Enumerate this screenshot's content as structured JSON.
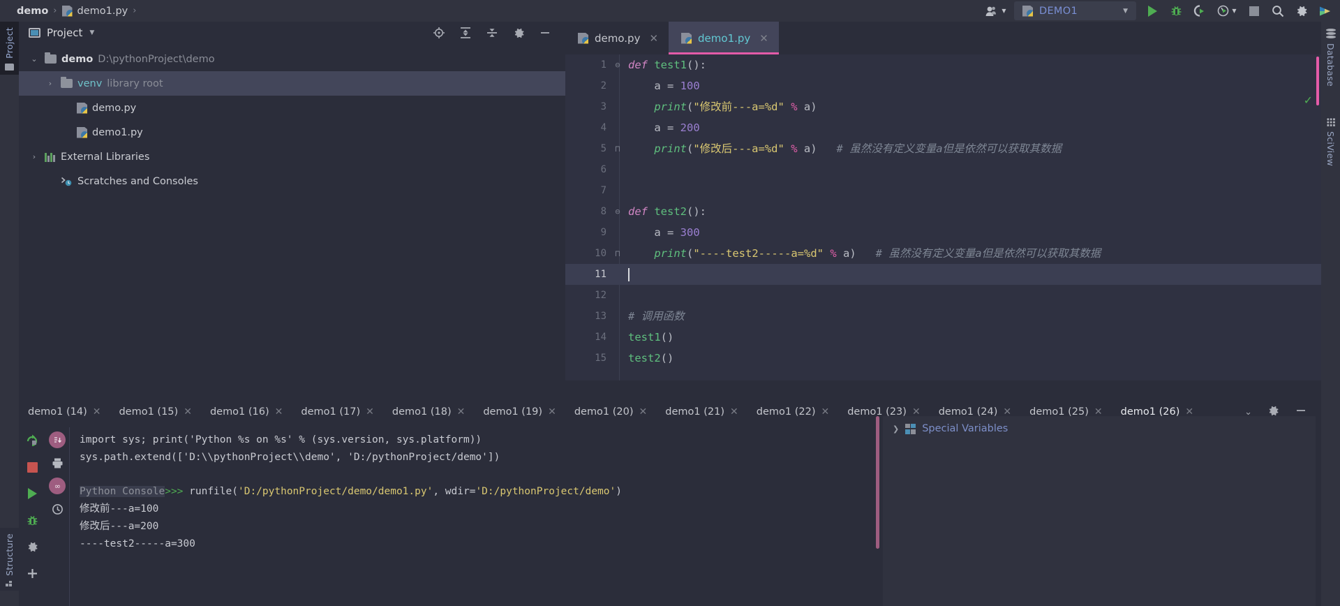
{
  "breadcrumb": {
    "root": "demo",
    "sep": "›",
    "file": "demo1.py",
    "trail": "›"
  },
  "toolbar": {
    "user_icon": "user-dropdown-icon",
    "run_config": "DEMO1",
    "run_label": "run-icon",
    "debug_label": "debug-icon",
    "coverage_label": "run-coverage-icon",
    "profile_label": "profile-icon",
    "stop_label": "stop-icon",
    "search_label": "search-icon",
    "settings_label": "settings-icon",
    "updates_label": "updates-icon"
  },
  "left_rail": {
    "project_tab": "Project",
    "structure_tab": "Structure"
  },
  "right_rail": {
    "database_tab": "Database",
    "sciview_tab": "SciView"
  },
  "project_panel": {
    "title": "Project",
    "toolbar_icons": [
      "locate-icon",
      "expand-all-icon",
      "collapse-all-icon",
      "settings-icon",
      "hide-icon"
    ],
    "tree": [
      {
        "indent": 1,
        "chevron": "⌄",
        "icon": "folder",
        "name": "demo",
        "bold": true,
        "sub": "D:\\pythonProject\\demo",
        "selected": false
      },
      {
        "indent": 2,
        "chevron": "›",
        "icon": "folder",
        "name": "venv",
        "teal": true,
        "sub": "library root",
        "selected": true
      },
      {
        "indent": 3,
        "chevron": "",
        "icon": "python",
        "name": "demo.py",
        "sub": "",
        "selected": false
      },
      {
        "indent": 3,
        "chevron": "",
        "icon": "python",
        "name": "demo1.py",
        "sub": "",
        "selected": false
      },
      {
        "indent": 1,
        "chevron": "›",
        "icon": "libraries",
        "name": "External Libraries",
        "sub": "",
        "selected": false
      },
      {
        "indent": 2,
        "chevron": "",
        "icon": "scratches",
        "name": "Scratches and Consoles",
        "sub": "",
        "selected": false
      }
    ]
  },
  "editor": {
    "tabs": [
      {
        "label": "demo.py",
        "active": false
      },
      {
        "label": "demo1.py",
        "active": true
      }
    ],
    "lines": [
      {
        "n": "1",
        "fold": "⊖",
        "current": false,
        "tokens": [
          {
            "t": "def ",
            "c": "kw"
          },
          {
            "t": "test1",
            "c": "fn"
          },
          {
            "t": "():",
            "c": "pun"
          }
        ]
      },
      {
        "n": "2",
        "fold": "",
        "current": false,
        "tokens": [
          {
            "t": "    a ",
            "c": "var"
          },
          {
            "t": "= ",
            "c": "pun"
          },
          {
            "t": "100",
            "c": "num"
          }
        ]
      },
      {
        "n": "3",
        "fold": "",
        "current": false,
        "tokens": [
          {
            "t": "    ",
            "c": "var"
          },
          {
            "t": "print",
            "c": "fn-it"
          },
          {
            "t": "(",
            "c": "pun"
          },
          {
            "t": "\"修改前---a=%d\"",
            "c": "str"
          },
          {
            "t": " ",
            "c": "pun"
          },
          {
            "t": "%",
            "c": "op"
          },
          {
            "t": " a)",
            "c": "pun"
          }
        ]
      },
      {
        "n": "4",
        "fold": "",
        "current": false,
        "tokens": [
          {
            "t": "    a ",
            "c": "var"
          },
          {
            "t": "= ",
            "c": "pun"
          },
          {
            "t": "200",
            "c": "num"
          }
        ]
      },
      {
        "n": "5",
        "fold": "⊓",
        "current": false,
        "tokens": [
          {
            "t": "    ",
            "c": "var"
          },
          {
            "t": "print",
            "c": "fn-it"
          },
          {
            "t": "(",
            "c": "pun"
          },
          {
            "t": "\"修改后---a=%d\"",
            "c": "str"
          },
          {
            "t": " ",
            "c": "pun"
          },
          {
            "t": "%",
            "c": "op"
          },
          {
            "t": " a)",
            "c": "pun"
          },
          {
            "t": "   # 虽然没有定义变量a但是依然可以获取其数据",
            "c": "cmt"
          }
        ]
      },
      {
        "n": "6",
        "fold": "",
        "current": false,
        "tokens": []
      },
      {
        "n": "7",
        "fold": "",
        "current": false,
        "tokens": []
      },
      {
        "n": "8",
        "fold": "⊖",
        "current": false,
        "tokens": [
          {
            "t": "def ",
            "c": "kw"
          },
          {
            "t": "test2",
            "c": "fn"
          },
          {
            "t": "():",
            "c": "pun"
          }
        ]
      },
      {
        "n": "9",
        "fold": "",
        "current": false,
        "tokens": [
          {
            "t": "    a ",
            "c": "var"
          },
          {
            "t": "= ",
            "c": "pun"
          },
          {
            "t": "300",
            "c": "num"
          }
        ]
      },
      {
        "n": "10",
        "fold": "⊓",
        "current": false,
        "tokens": [
          {
            "t": "    ",
            "c": "var"
          },
          {
            "t": "print",
            "c": "fn-it"
          },
          {
            "t": "(",
            "c": "pun"
          },
          {
            "t": "\"----test2-----a=%d\"",
            "c": "str"
          },
          {
            "t": " ",
            "c": "pun"
          },
          {
            "t": "%",
            "c": "op"
          },
          {
            "t": " a)",
            "c": "pun"
          },
          {
            "t": "   # 虽然没有定义变量a但是依然可以获取其数据",
            "c": "cmt"
          }
        ]
      },
      {
        "n": "11",
        "fold": "",
        "current": true,
        "tokens": []
      },
      {
        "n": "12",
        "fold": "",
        "current": false,
        "tokens": []
      },
      {
        "n": "13",
        "fold": "",
        "current": false,
        "tokens": [
          {
            "t": "# 调用函数",
            "c": "cmt"
          }
        ]
      },
      {
        "n": "14",
        "fold": "",
        "current": false,
        "tokens": [
          {
            "t": "test1",
            "c": "fn"
          },
          {
            "t": "()",
            "c": "pun"
          }
        ]
      },
      {
        "n": "15",
        "fold": "",
        "current": false,
        "tokens": [
          {
            "t": "test2",
            "c": "fn"
          },
          {
            "t": "()",
            "c": "pun"
          }
        ]
      }
    ]
  },
  "console": {
    "tabs": [
      {
        "label": "demo1 (14)",
        "active": false
      },
      {
        "label": "demo1 (15)",
        "active": false
      },
      {
        "label": "demo1 (16)",
        "active": false
      },
      {
        "label": "demo1 (17)",
        "active": false
      },
      {
        "label": "demo1 (18)",
        "active": false
      },
      {
        "label": "demo1 (19)",
        "active": false
      },
      {
        "label": "demo1 (20)",
        "active": false
      },
      {
        "label": "demo1 (21)",
        "active": false
      },
      {
        "label": "demo1 (22)",
        "active": false
      },
      {
        "label": "demo1 (23)",
        "active": false
      },
      {
        "label": "demo1 (24)",
        "active": false
      },
      {
        "label": "demo1 (25)",
        "active": false
      },
      {
        "label": "demo1 (26)",
        "active": true
      }
    ],
    "rail_icons": [
      "rerun-icon",
      "stop-icon",
      "resume-icon",
      "debug-icon",
      "settings-icon",
      "add-icon"
    ],
    "side_icons": [
      "import-icon",
      "print-icon",
      "eyes-icon",
      "history-icon"
    ],
    "output": [
      {
        "type": "plain",
        "text": "import sys; print('Python %s on %s' % (sys.version, sys.platform))"
      },
      {
        "type": "plain",
        "text": "sys.path.extend(['D:\\\\pythonProject\\\\demo', 'D:/pythonProject/demo'])"
      },
      {
        "type": "gap",
        "text": ""
      },
      {
        "type": "prompt",
        "label": "Python Console",
        "arrow": ">>> ",
        "call_pre": "runfile(",
        "arg1": "'D:/pythonProject/demo/demo1.py'",
        "mid": ", wdir=",
        "arg2": "'D:/pythonProject/demo'",
        "call_post": ")"
      },
      {
        "type": "plain",
        "text": "修改前---a=100"
      },
      {
        "type": "plain",
        "text": "修改后---a=200"
      },
      {
        "type": "plain",
        "text": "----test2-----a=300"
      }
    ],
    "special_variables": "Special Variables",
    "right_controls": [
      "chevron-down-icon",
      "settings-icon",
      "hide-icon"
    ]
  },
  "colors": {
    "accent_pink": "#e45ba8",
    "run_green": "#4fad52",
    "tab_blue": "#62c9d3",
    "bg": "#2b2d3a"
  }
}
